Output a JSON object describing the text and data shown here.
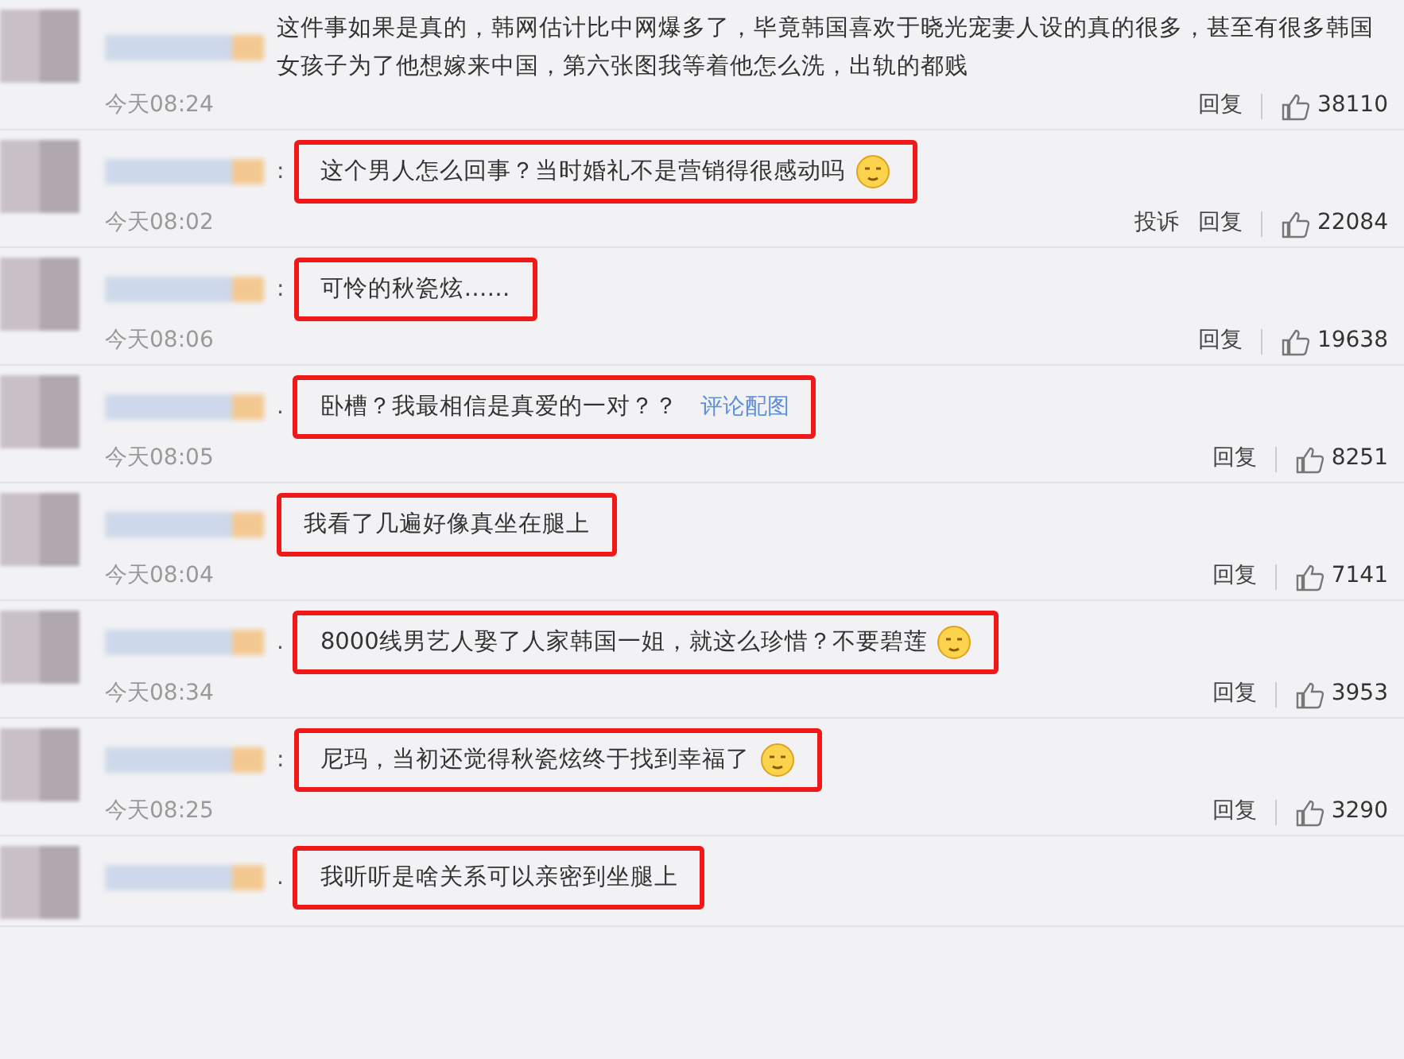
{
  "comments": [
    {
      "text": "这件事如果是真的，韩网估计比中网爆多了，毕竟韩国喜欢于晓光宠妻人设的真的很多，甚至有很多韩国女孩子为了他想嫁来中国，第六张图我等着他怎么洗，出轨的都贱",
      "highlighted": false,
      "time": "今天08:24",
      "reply": "回复",
      "likes": "38110"
    },
    {
      "separator": ":",
      "text": "这个男人怎么回事？当时婚礼不是营销得很感动吗",
      "emoji": true,
      "highlighted": true,
      "time": "今天08:02",
      "report": "投诉",
      "reply": "回复",
      "likes": "22084"
    },
    {
      "separator": ":",
      "text": "可怜的秋瓷炫……",
      "highlighted": true,
      "time": "今天08:06",
      "reply": "回复",
      "likes": "19638"
    },
    {
      "separator": ".",
      "text": "卧槽？我最相信是真爱的一对？？",
      "link": "评论配图",
      "highlighted": true,
      "time": "今天08:05",
      "reply": "回复",
      "likes": "8251"
    },
    {
      "text": "我看了几遍好像真坐在腿上",
      "highlighted": true,
      "time": "今天08:04",
      "reply": "回复",
      "likes": "7141"
    },
    {
      "separator": ".",
      "text": "8000线男艺人娶了人家韩国一姐，就这么珍惜？不要碧莲",
      "emoji": true,
      "highlighted": true,
      "time": "今天08:34",
      "reply": "回复",
      "likes": "3953"
    },
    {
      "separator": ":",
      "text": "尼玛，当初还觉得秋瓷炫终于找到幸福了",
      "emoji": true,
      "highlighted": true,
      "time": "今天08:25",
      "reply": "回复",
      "likes": "3290"
    },
    {
      "separator": ".",
      "text": "我听听是啥关系可以亲密到坐腿上",
      "highlighted": true
    }
  ]
}
